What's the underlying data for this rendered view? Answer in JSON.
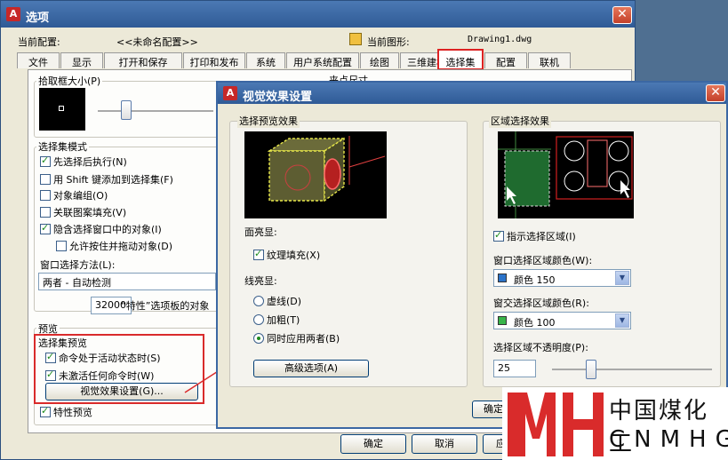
{
  "main": {
    "title": "选项",
    "config_label": "当前配置:",
    "config_value": "<<未命名配置>>",
    "drawing_label": "当前图形:",
    "drawing_value": "Drawing1.dwg",
    "tabs": [
      "文件",
      "显示",
      "打开和保存",
      "打印和发布",
      "系统",
      "用户系统配置",
      "绘图",
      "三维建模",
      "选择集",
      "配置",
      "联机"
    ],
    "active_tab": "选择集",
    "pickbox_label": "拾取框大小(P)",
    "grip_partial": "夹点尺寸",
    "selection_mode_label": "选择集模式",
    "modes": [
      {
        "label": "先选择后执行(N)",
        "checked": true
      },
      {
        "label": "用 Shift 键添加到选择集(F)",
        "checked": false
      },
      {
        "label": "对象编组(O)",
        "checked": false
      },
      {
        "label": "关联图案填充(V)",
        "checked": false
      },
      {
        "label": "隐含选择窗口中的对象(I)",
        "checked": true
      }
    ],
    "allow_drag_label": "允许按住并拖动对象(D)",
    "allow_drag_checked": false,
    "window_method_label": "窗口选择方法(L):",
    "window_method_value": "两者 - 自动检测",
    "limit_value": "32000",
    "limit_label": "“特性”选项板的对象",
    "preview_label": "预览",
    "sel_preview_label": "选择集预览",
    "preview_options": [
      {
        "label": "命令处于活动状态时(S)",
        "checked": true
      },
      {
        "label": "未激活任何命令时(W)",
        "checked": true
      }
    ],
    "visual_effect_button": "视觉效果设置(G)...",
    "prop_preview_label": "特性预览",
    "prop_preview_checked": true,
    "ok_button": "确定",
    "cancel_button": "取消",
    "apply_button": "应"
  },
  "sub": {
    "title": "视觉效果设置",
    "preview_group_label": "选择预览效果",
    "face_highlight_label": "面亮显:",
    "texture_fill_label": "纹理填充(X)",
    "texture_fill_checked": true,
    "line_highlight_label": "线亮显:",
    "line_options": [
      {
        "label": "虚线(D)",
        "selected": false
      },
      {
        "label": "加粗(T)",
        "selected": false
      },
      {
        "label": "同时应用两者(B)",
        "selected": true
      }
    ],
    "advanced_button": "高级选项(A)",
    "area_group_label": "区域选择效果",
    "indicate_area_label": "指示选择区域(I)",
    "indicate_area_checked": true,
    "window_color_label": "窗口选择区域颜色(W):",
    "window_color_value": "颜色 150",
    "window_color_hex": "#2b73c9",
    "crossing_color_label": "窗交选择区域颜色(R):",
    "crossing_color_value": "颜色 100",
    "crossing_color_hex": "#39b54a",
    "opacity_label": "选择区域不透明度(P):",
    "opacity_value": "25",
    "ok_button_partial": "确定"
  },
  "watermark": {
    "cn": "中国煤化工",
    "en": "CNMHG"
  },
  "colors": {
    "title_blue": "#2f5a96",
    "highlight_red": "#d92b2b",
    "dialog_bg": "#ece9d8"
  }
}
